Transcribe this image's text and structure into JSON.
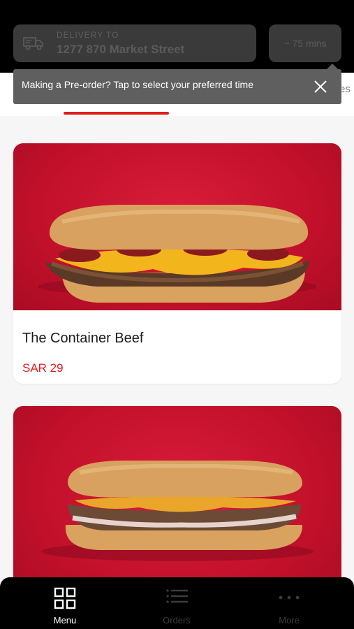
{
  "header": {
    "delivery_label": "DELIVERY TO",
    "delivery_address": "1277 870 Market Street",
    "eta": "~ 75 mins"
  },
  "tooltip": {
    "text": "Making a Pre-order? Tap to select your preferred time"
  },
  "tabs": {
    "peek_label": "es"
  },
  "items": [
    {
      "name": "The Container Beef",
      "price": "SAR 29"
    },
    {
      "name": "",
      "price": ""
    }
  ],
  "bottom_nav": [
    {
      "label": "Menu",
      "icon": "grid-icon",
      "active": true
    },
    {
      "label": "Orders",
      "icon": "list-icon",
      "active": false
    },
    {
      "label": "More",
      "icon": "more-dots-icon",
      "active": false
    }
  ],
  "colors": {
    "accent": "#e01d1d",
    "header_bg": "#000000",
    "tooltip_bg": "#5f5f5f",
    "card_image_bg": "#c2102b"
  }
}
